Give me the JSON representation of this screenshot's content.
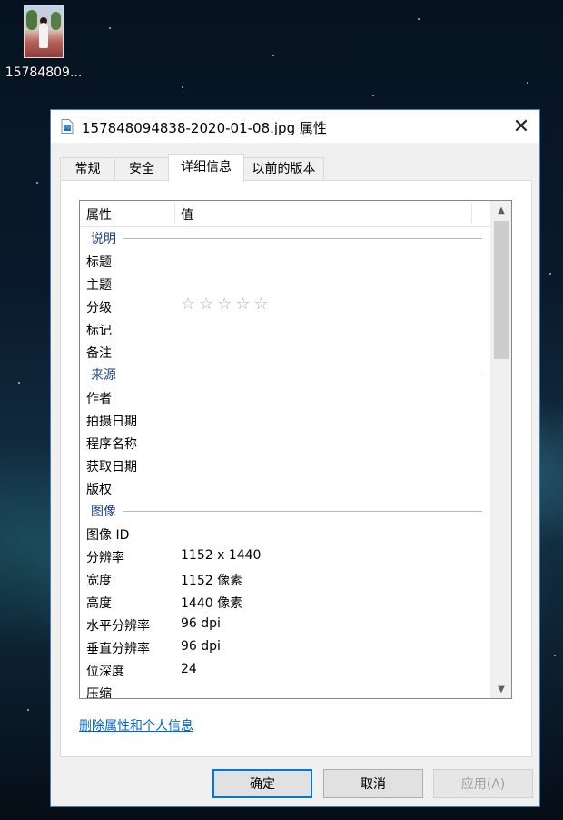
{
  "desktop": {
    "icon_label": "15784809..."
  },
  "dialog": {
    "title": "157848094838-2020-01-08.jpg 属性",
    "close_symbol": "✕",
    "tabs": [
      {
        "label": "常规"
      },
      {
        "label": "安全"
      },
      {
        "label": "详细信息"
      },
      {
        "label": "以前的版本"
      }
    ],
    "active_tab": "详细信息",
    "table": {
      "header_property": "属性",
      "header_value": "值",
      "groups": [
        {
          "name": "说明",
          "rows": [
            {
              "k": "标题",
              "v": ""
            },
            {
              "k": "主题",
              "v": ""
            },
            {
              "k": "分级",
              "v": "☆☆☆☆☆"
            },
            {
              "k": "标记",
              "v": ""
            },
            {
              "k": "备注",
              "v": ""
            }
          ]
        },
        {
          "name": "来源",
          "rows": [
            {
              "k": "作者",
              "v": ""
            },
            {
              "k": "拍摄日期",
              "v": ""
            },
            {
              "k": "程序名称",
              "v": ""
            },
            {
              "k": "获取日期",
              "v": ""
            },
            {
              "k": "版权",
              "v": ""
            }
          ]
        },
        {
          "name": "图像",
          "rows": [
            {
              "k": "图像 ID",
              "v": ""
            },
            {
              "k": "分辨率",
              "v": "1152 x 1440"
            },
            {
              "k": "宽度",
              "v": "1152 像素"
            },
            {
              "k": "高度",
              "v": "1440 像素"
            },
            {
              "k": "水平分辨率",
              "v": "96 dpi"
            },
            {
              "k": "垂直分辨率",
              "v": "96 dpi"
            },
            {
              "k": "位深度",
              "v": "24"
            },
            {
              "k": "压缩",
              "v": ""
            }
          ]
        }
      ]
    },
    "scroll": {
      "up": "▲",
      "down": "▼"
    },
    "remove_link": "删除属性和个人信息",
    "buttons": {
      "ok": "确定",
      "cancel": "取消",
      "apply": "应用(A)"
    }
  }
}
